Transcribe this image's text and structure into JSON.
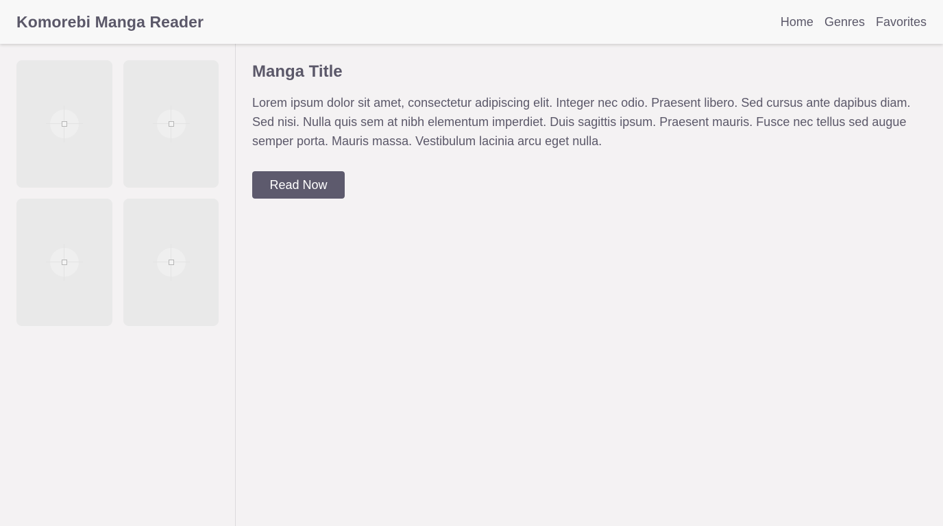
{
  "header": {
    "brand": "Komorebi Manga Reader",
    "nav": [
      "Home",
      "Genres",
      "Favorites"
    ]
  },
  "sidebar": {
    "covers": [
      {
        "icon": "image-placeholder-icon"
      },
      {
        "icon": "image-placeholder-icon"
      },
      {
        "icon": "image-placeholder-icon"
      },
      {
        "icon": "image-placeholder-icon"
      }
    ]
  },
  "main": {
    "title": "Manga Title",
    "description": "Lorem ipsum dolor sit amet, consectetur adipiscing elit. Integer nec odio. Praesent libero. Sed cursus ante dapibus diam. Sed nisi. Nulla quis sem at nibh elementum imperdiet. Duis sagittis ipsum. Praesent mauris. Fusce nec tellus sed augue semper porta. Mauris massa. Vestibulum lacinia arcu eget nulla.",
    "read_button": "Read Now"
  },
  "colors": {
    "text": "#5b5869",
    "button": "#5d5a6d",
    "background": "#f4f2f3",
    "header_bg": "#f8f8f8",
    "cover_bg": "#e9e9e9"
  }
}
